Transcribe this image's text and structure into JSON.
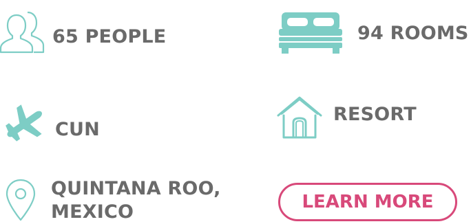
{
  "features": {
    "people": {
      "label": "65 PEOPLE",
      "icon": "people-icon"
    },
    "rooms": {
      "label": "94 ROOMS",
      "icon": "bed-icon"
    },
    "airport": {
      "label": "CUN",
      "icon": "airplane-icon"
    },
    "type": {
      "label": "RESORT",
      "icon": "house-icon"
    },
    "location": {
      "line1": "QUINTANA ROO,",
      "line2": "MEXICO",
      "icon": "location-pin-icon"
    }
  },
  "cta": {
    "label": "LEARN MORE"
  },
  "colors": {
    "icon_teal": "#7dcdc5",
    "text_gray": "#6a6a6a",
    "accent_pink": "#d8497a"
  }
}
